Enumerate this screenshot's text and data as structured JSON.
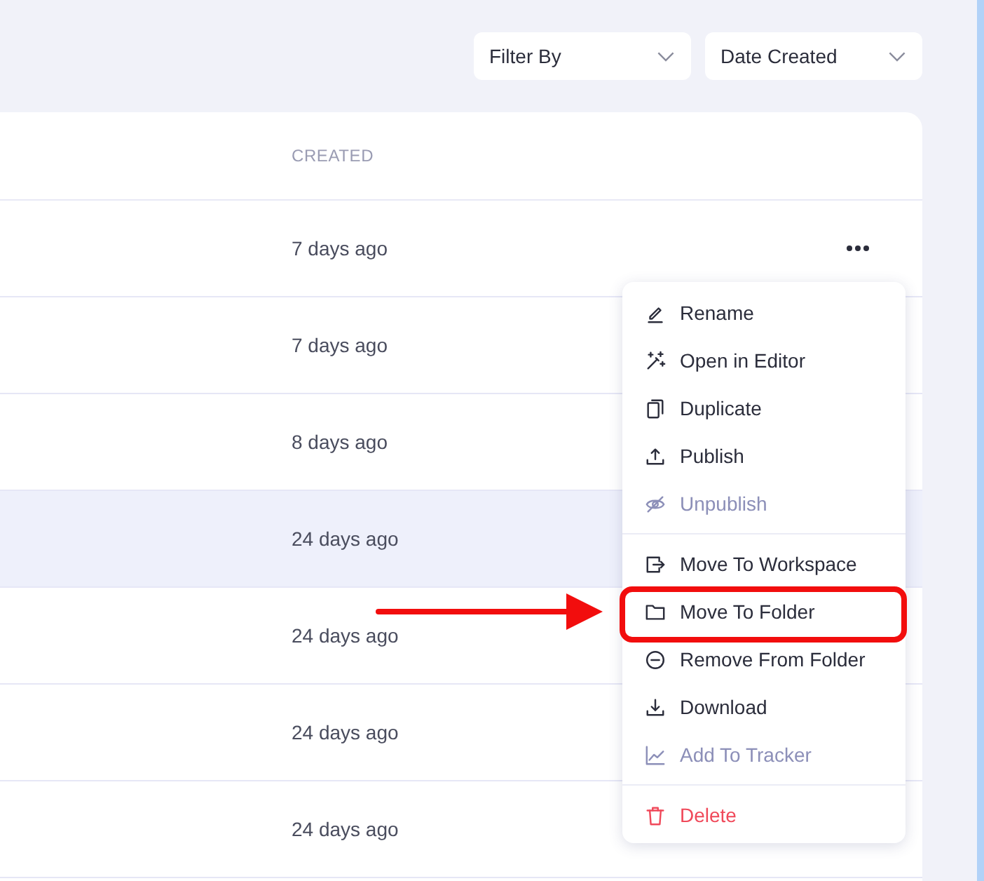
{
  "toolbar": {
    "dropdowns": [
      {
        "label": "Filter By"
      },
      {
        "label": "Date Created"
      }
    ]
  },
  "table": {
    "columns": [
      {
        "label": "CREATED"
      }
    ],
    "rows": [
      {
        "created": "7 days ago",
        "hovered": false,
        "menu_open": true
      },
      {
        "created": "7 days ago",
        "hovered": false,
        "menu_open": false
      },
      {
        "created": "8 days ago",
        "hovered": false,
        "menu_open": false
      },
      {
        "created": "24 days ago",
        "hovered": true,
        "menu_open": false
      },
      {
        "created": "24 days ago",
        "hovered": false,
        "menu_open": false
      },
      {
        "created": "24 days ago",
        "hovered": false,
        "menu_open": false
      },
      {
        "created": "24 days ago",
        "hovered": false,
        "menu_open": false
      }
    ]
  },
  "context_menu": {
    "sections": [
      {
        "items": [
          {
            "label": "Rename",
            "kind": "action",
            "disabled": false,
            "highlighted": false
          },
          {
            "label": "Open in Editor",
            "kind": "action",
            "disabled": false,
            "highlighted": false
          },
          {
            "label": "Duplicate",
            "kind": "action",
            "disabled": false,
            "highlighted": false
          },
          {
            "label": "Publish",
            "kind": "action",
            "disabled": false,
            "highlighted": false
          },
          {
            "label": "Unpublish",
            "kind": "action",
            "disabled": true,
            "highlighted": false
          }
        ]
      },
      {
        "items": [
          {
            "label": "Move To Workspace",
            "kind": "action",
            "disabled": false,
            "highlighted": false
          },
          {
            "label": "Move To Folder",
            "kind": "action",
            "disabled": false,
            "highlighted": true
          },
          {
            "label": "Remove From Folder",
            "kind": "action",
            "disabled": false,
            "highlighted": false
          },
          {
            "label": "Download",
            "kind": "action",
            "disabled": false,
            "highlighted": false
          },
          {
            "label": "Add To Tracker",
            "kind": "action",
            "disabled": true,
            "highlighted": false
          }
        ]
      },
      {
        "items": [
          {
            "label": "Delete",
            "kind": "danger",
            "disabled": false,
            "highlighted": false
          }
        ]
      }
    ]
  }
}
